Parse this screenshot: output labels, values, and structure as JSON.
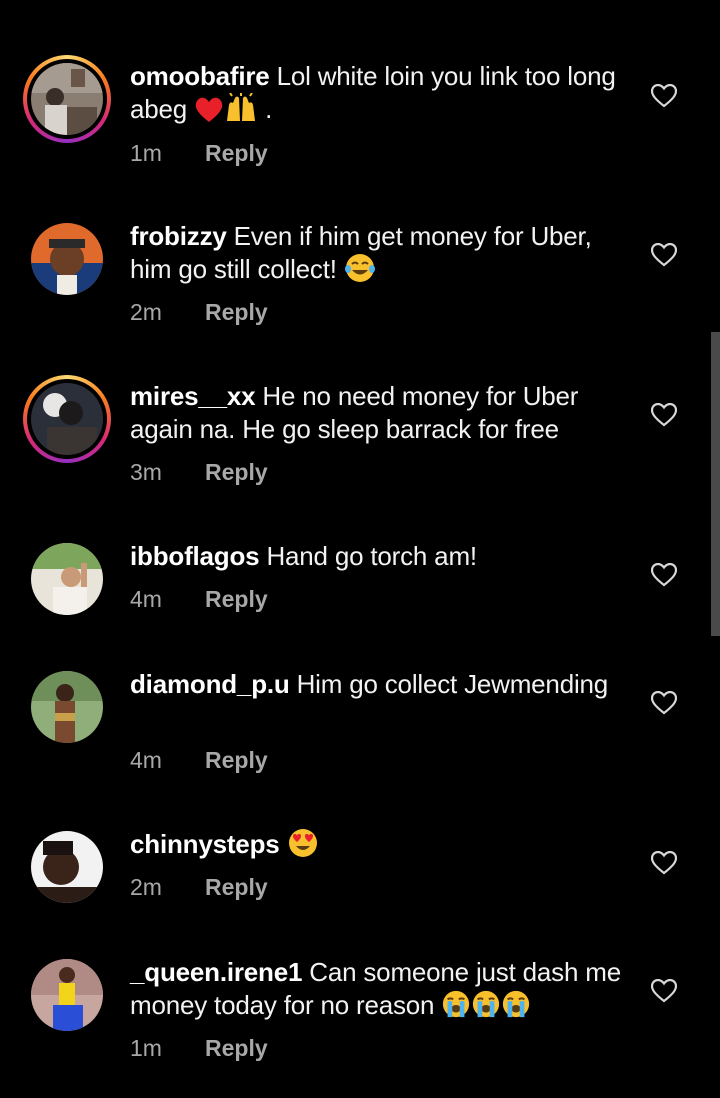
{
  "colors": {
    "background": "#000000",
    "text": "#f5f5f5",
    "muted": "#a8a8a8",
    "story_ring": [
      "#feda75",
      "#fa7e1e",
      "#d62976",
      "#962fbf"
    ]
  },
  "comments": [
    {
      "username": "omoobafire",
      "text": "Lol white loin you link too long abeg",
      "emojis": [
        "red-heart-emoji",
        "raising-hands-emoji"
      ],
      "trailing": ".",
      "time": "1m",
      "reply_label": "Reply",
      "has_story": true,
      "like_icon": "heart-outline-icon"
    },
    {
      "username": "frobizzy",
      "text": "Even if him get money for Uber, him go still collect!",
      "emojis": [
        "tears-of-joy-emoji"
      ],
      "time": "2m",
      "reply_label": "Reply",
      "has_story": false,
      "like_icon": "heart-outline-icon"
    },
    {
      "username": "mires__xx",
      "text": "He no need money for Uber again na. He go sleep barrack for free",
      "emojis": [],
      "time": "3m",
      "reply_label": "Reply",
      "has_story": true,
      "like_icon": "heart-outline-icon"
    },
    {
      "username": "ibboflagos",
      "text": "Hand go torch am!",
      "emojis": [],
      "time": "4m",
      "reply_label": "Reply",
      "has_story": false,
      "like_icon": "heart-outline-icon"
    },
    {
      "username": "diamond_p.u",
      "text": "Him go collect Jewmending",
      "emojis": [],
      "time": "4m",
      "reply_label": "Reply",
      "has_story": false,
      "like_icon": "heart-outline-icon"
    },
    {
      "username": "chinnysteps",
      "text": "",
      "emojis": [
        "heart-eyes-emoji"
      ],
      "time": "2m",
      "reply_label": "Reply",
      "has_story": false,
      "like_icon": "heart-outline-icon"
    },
    {
      "username": "_queen.irene1",
      "text": "Can someone just dash me money today for no reason",
      "emojis": [
        "loudly-crying-emoji",
        "loudly-crying-emoji",
        "loudly-crying-emoji"
      ],
      "time": "1m",
      "reply_label": "Reply",
      "has_story": false,
      "like_icon": "heart-outline-icon"
    }
  ]
}
